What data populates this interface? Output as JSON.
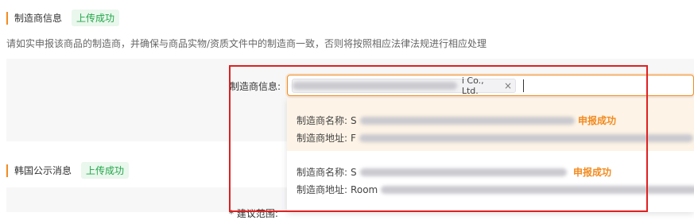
{
  "sections": {
    "manufacturer": {
      "title": "制造商信息",
      "badge": "上传成功"
    },
    "korea": {
      "title": "韩国公示消息",
      "badge": "上传成功"
    }
  },
  "hint": "请如实申报该商品的制造商，并确保与商品实物/资质文件中的制造商一致，否则将按照相应法律法规进行相应处理",
  "field": {
    "label": "制造商信息:",
    "tag_suffix": "i Co., Ltd.",
    "tag_close": "×"
  },
  "dropdown": {
    "options": [
      {
        "name_label": "制造商名称:",
        "name_prefix": "S",
        "address_label": "制造商地址:",
        "address_prefix": "F",
        "status": "申报成功"
      },
      {
        "name_label": "制造商名称:",
        "name_prefix": "S",
        "address_label": "制造商地址:",
        "address_prefix": "Room",
        "status": "申报成功"
      }
    ]
  },
  "partial_label": "* 建议范围:",
  "colors": {
    "accent": "#f28b20",
    "success": "#22a64a",
    "highlight": "#e02020"
  }
}
